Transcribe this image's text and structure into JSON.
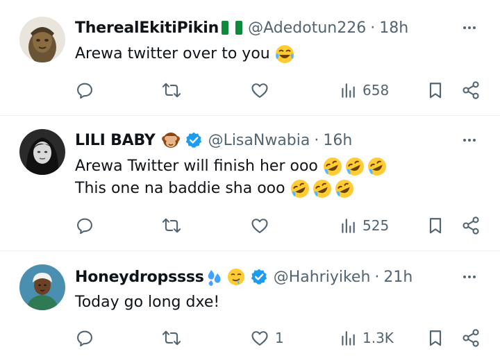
{
  "tweets": [
    {
      "display_name": "TherealEkitiPikin",
      "name_emoji": "nigeria-flag",
      "verified": false,
      "handle": "@Adedotun226",
      "separator": "·",
      "time": "18h",
      "lines": [
        {
          "text": "Arewa twitter over to you",
          "emojis": [
            "face-with-tears-of-joy"
          ]
        }
      ],
      "reply_count": "",
      "repost_count": "",
      "like_count": "",
      "view_count": "658"
    },
    {
      "display_name": "LILI BABY",
      "name_emoji": "see-no-evil-monkey",
      "verified": true,
      "handle": "@LisaNwabia",
      "separator": "·",
      "time": "16h",
      "lines": [
        {
          "text": "Arewa Twitter will finish her ooo",
          "emojis": [
            "rolling-on-floor-laughing",
            "rolling-on-floor-laughing",
            "rolling-on-floor-laughing"
          ]
        },
        {
          "text": "This one na baddie sha ooo",
          "emojis": [
            "rolling-on-floor-laughing",
            "rolling-on-floor-laughing",
            "rolling-on-floor-laughing"
          ]
        }
      ],
      "reply_count": "",
      "repost_count": "",
      "like_count": "",
      "view_count": "525"
    },
    {
      "display_name": "Honeydropssss",
      "name_emoji": "sweat-droplets, drooling-face",
      "verified": true,
      "handle": "@Hahriyikeh",
      "separator": "·",
      "time": "21h",
      "lines": [
        {
          "text": "Today go long dxe!",
          "emojis": []
        }
      ],
      "reply_count": "",
      "repost_count": "",
      "like_count": "1",
      "view_count": "1.3K"
    }
  ],
  "colors": {
    "text_primary": "#0f1419",
    "text_secondary": "#536471",
    "verified_blue": "#1d9bf0",
    "divider": "#eff3f4"
  },
  "icons": [
    "reply-icon",
    "repost-icon",
    "like-icon",
    "views-icon",
    "bookmark-icon",
    "share-icon",
    "more-icon",
    "verified-badge-icon"
  ]
}
